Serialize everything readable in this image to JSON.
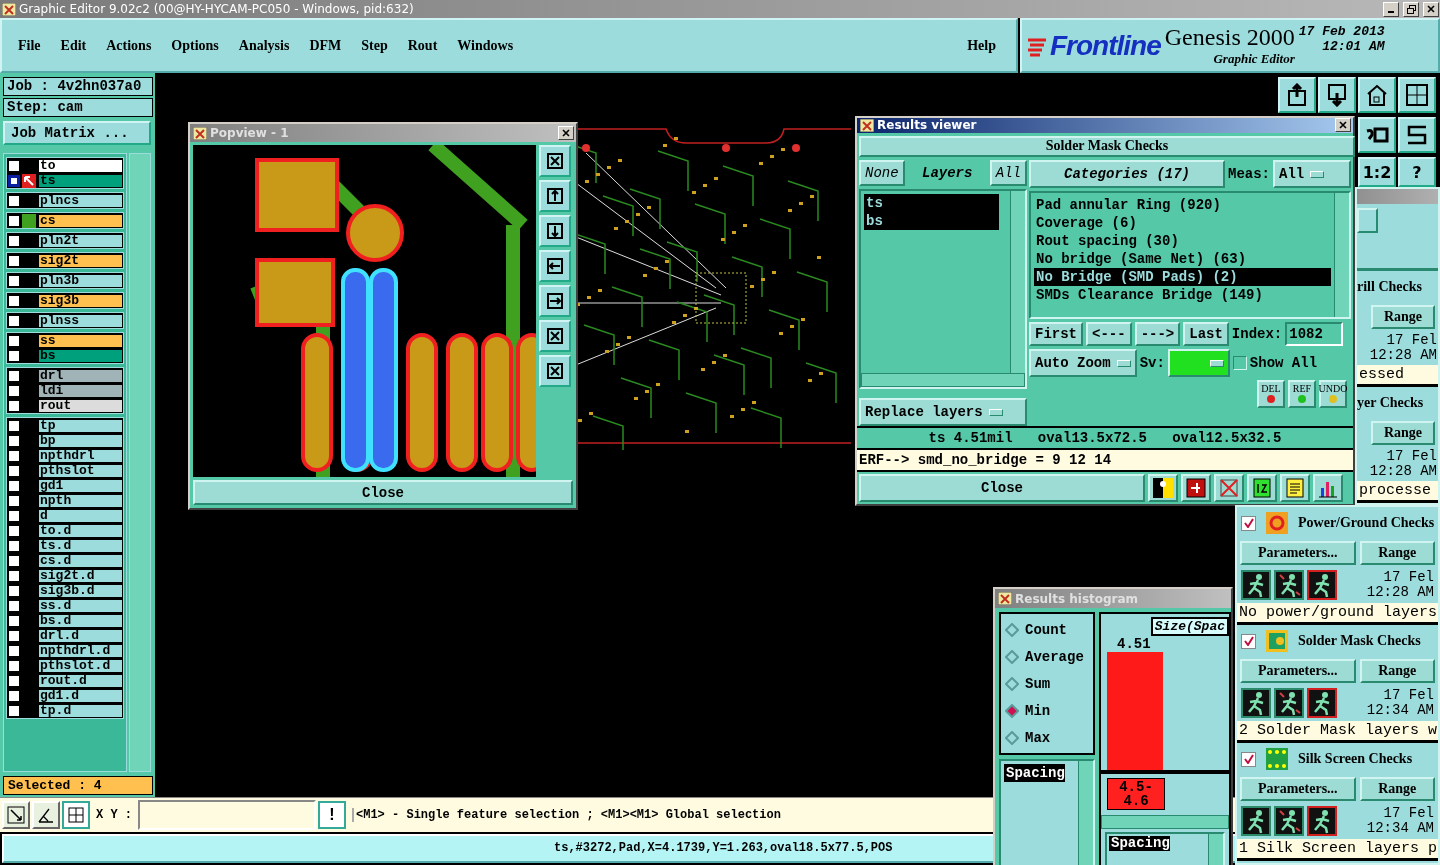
{
  "window": {
    "title": "Graphic Editor 9.02c2 (00@HY-HYCAM-PC050 - Windows, pid:632)"
  },
  "menu": {
    "items": [
      "File",
      "Edit",
      "Actions",
      "Options",
      "Analysis",
      "DFM",
      "Step",
      "Rout",
      "Windows"
    ],
    "help": "Help"
  },
  "brand": {
    "logo": "Frontline",
    "product": "Genesis 2000",
    "subtitle": "Graphic Editor",
    "date": "17 Feb 2013",
    "time": "12:01 AM"
  },
  "job": {
    "job": "Job : 4v2hn037a0",
    "step": "Step: cam",
    "matrix_button": "Job Matrix ..."
  },
  "layer_groups": [
    {
      "layers": [
        {
          "name": "to",
          "color": "#ffffff",
          "selected": false,
          "work": false,
          "shown": false
        },
        {
          "name": "ts",
          "color": "#00a07c",
          "selected": true,
          "work": true,
          "shown": false
        }
      ]
    },
    {
      "layers": [
        {
          "name": "plncs",
          "color": "#9cdcdc",
          "selected": false,
          "work": false,
          "shown": false
        }
      ]
    },
    {
      "layers": [
        {
          "name": "cs",
          "color": "#ffc050",
          "selected": false,
          "work": false,
          "shown": true
        }
      ]
    },
    {
      "layers": [
        {
          "name": "pln2t",
          "color": "#9cdcdc",
          "selected": false,
          "work": false,
          "shown": false
        }
      ]
    },
    {
      "layers": [
        {
          "name": "sig2t",
          "color": "#ffc050",
          "selected": false,
          "work": false,
          "shown": false
        }
      ]
    },
    {
      "layers": [
        {
          "name": "pln3b",
          "color": "#9cdcdc",
          "selected": false,
          "work": false,
          "shown": false
        }
      ]
    },
    {
      "layers": [
        {
          "name": "sig3b",
          "color": "#ffc050",
          "selected": false,
          "work": false,
          "shown": false
        }
      ]
    },
    {
      "layers": [
        {
          "name": "plnss",
          "color": "#9cdcdc",
          "selected": false,
          "work": false,
          "shown": false
        }
      ]
    },
    {
      "layers": [
        {
          "name": "ss",
          "color": "#ffc050",
          "selected": false,
          "work": false,
          "shown": false
        },
        {
          "name": "bs",
          "color": "#00a07c",
          "selected": false,
          "work": false,
          "shown": false
        }
      ]
    },
    {
      "layers": [
        {
          "name": "drl",
          "color": "#a0b4b8",
          "selected": false,
          "work": false,
          "shown": false
        },
        {
          "name": "ldi",
          "color": "#a0b4b8",
          "selected": false,
          "work": false,
          "shown": false
        },
        {
          "name": "rout",
          "color": "#dcdcdc",
          "selected": false,
          "work": false,
          "shown": false
        }
      ]
    },
    {
      "layers": [
        {
          "name": "tp",
          "color": "#9cdcdc",
          "selected": false,
          "work": false,
          "shown": false
        },
        {
          "name": "bp",
          "color": "#9cdcdc",
          "selected": false,
          "work": false,
          "shown": false
        },
        {
          "name": "npthdrl",
          "color": "#9cdcdc",
          "selected": false,
          "work": false,
          "shown": false
        },
        {
          "name": "pthslot",
          "color": "#9cdcdc",
          "selected": false,
          "work": false,
          "shown": false
        },
        {
          "name": "gd1",
          "color": "#9cdcdc",
          "selected": false,
          "work": false,
          "shown": false
        },
        {
          "name": "npth",
          "color": "#9cdcdc",
          "selected": false,
          "work": false,
          "shown": false
        },
        {
          "name": "d",
          "color": "#9cdcdc",
          "selected": false,
          "work": false,
          "shown": false
        },
        {
          "name": "to.d",
          "color": "#9cdcdc",
          "selected": false,
          "work": false,
          "shown": false
        },
        {
          "name": "ts.d",
          "color": "#9cdcdc",
          "selected": false,
          "work": false,
          "shown": false
        },
        {
          "name": "cs.d",
          "color": "#9cdcdc",
          "selected": false,
          "work": false,
          "shown": false
        },
        {
          "name": "sig2t.d",
          "color": "#9cdcdc",
          "selected": false,
          "work": false,
          "shown": false
        },
        {
          "name": "sig3b.d",
          "color": "#9cdcdc",
          "selected": false,
          "work": false,
          "shown": false
        },
        {
          "name": "ss.d",
          "color": "#9cdcdc",
          "selected": false,
          "work": false,
          "shown": false
        },
        {
          "name": "bs.d",
          "color": "#9cdcdc",
          "selected": false,
          "work": false,
          "shown": false
        },
        {
          "name": "drl.d",
          "color": "#9cdcdc",
          "selected": false,
          "work": false,
          "shown": false
        },
        {
          "name": "npthdrl.d",
          "color": "#9cdcdc",
          "selected": false,
          "work": false,
          "shown": false
        },
        {
          "name": "pthslot.d",
          "color": "#9cdcdc",
          "selected": false,
          "work": false,
          "shown": false
        },
        {
          "name": "rout.d",
          "color": "#9cdcdc",
          "selected": false,
          "work": false,
          "shown": false
        },
        {
          "name": "gd1.d",
          "color": "#9cdcdc",
          "selected": false,
          "work": false,
          "shown": false
        },
        {
          "name": "tp.d",
          "color": "#9cdcdc",
          "selected": false,
          "work": false,
          "shown": false
        }
      ]
    }
  ],
  "selected_count": "Selected : 4",
  "toolbar": {
    "texts": [
      "1:2",
      "?"
    ]
  },
  "popview": {
    "title": "Popview - 1",
    "close": "Close"
  },
  "results_viewer": {
    "title": "Results viewer",
    "header": "Solder Mask Checks",
    "none_button": "None",
    "layers_label": "Layers",
    "all_button": "All",
    "layers": [
      {
        "name": "ts",
        "selected": true
      },
      {
        "name": "bs",
        "selected": true
      }
    ],
    "categories_label": "Categories (17)",
    "meas_label": "Meas:",
    "meas_value": "All",
    "categories": [
      {
        "label": "Pad annular Ring (920)",
        "selected": false
      },
      {
        "label": "Coverage (6)",
        "selected": false
      },
      {
        "label": "Rout spacing (30)",
        "selected": false
      },
      {
        "label": "No bridge (Same Net) (63)",
        "selected": false
      },
      {
        "label": "No Bridge (SMD Pads) (2)",
        "selected": true
      },
      {
        "label": "SMDs Clearance Bridge (149)",
        "selected": false
      }
    ],
    "nav_buttons": [
      "First",
      "<---",
      "--->",
      "Last"
    ],
    "index_label": "Index:",
    "index_value": "1082",
    "zoom_mode": "Auto Zoom",
    "sv_label": "Sv:",
    "show_all": {
      "label": "Show All",
      "checked": false
    },
    "replace": "Replace layers",
    "action_buttons": [
      "DEL",
      "REF",
      "UNDO"
    ],
    "info": "ts 4.51mil   oval13.5x72.5   oval12.5x32.5",
    "erf": "ERF--> smd_no_bridge = 9 12 14",
    "close": "Close"
  },
  "histogram": {
    "title": "Results histogram",
    "modes": [
      {
        "label": "Count",
        "selected": false
      },
      {
        "label": "Average",
        "selected": false
      },
      {
        "label": "Sum",
        "selected": false
      },
      {
        "label": "Min",
        "selected": true
      },
      {
        "label": "Max",
        "selected": false
      }
    ],
    "measures": [
      {
        "label": "Spacing",
        "selected": true
      }
    ],
    "column_title": "Size(Spac",
    "bars": [
      {
        "value": "4.51",
        "range": "4.5-4.6"
      }
    ],
    "lower_list": [
      {
        "label": "Spacing",
        "selected": true
      }
    ]
  },
  "checks_upper": [
    {
      "title": "rill Checks",
      "range": "Range",
      "date": "17 Fel",
      "time": "12:28 AM",
      "message": "essed"
    },
    {
      "title": "yer Checks",
      "range": "Range",
      "date": "17 Fel",
      "time": "12:28 AM",
      "message": "processe"
    }
  ],
  "checks": [
    {
      "kind": "power",
      "title": "Power/Ground Checks",
      "checked": true,
      "params": "Parameters...",
      "range": "Range",
      "date": "17 Fel",
      "time": "12:28 AM",
      "message": "No power/ground layers"
    },
    {
      "kind": "mask",
      "title": "Solder Mask Checks",
      "checked": true,
      "params": "Parameters...",
      "range": "Range",
      "date": "17 Fel",
      "time": "12:34 AM",
      "message": "2 Solder Mask layers w"
    },
    {
      "kind": "silk",
      "title": "Silk Screen Checks",
      "checked": true,
      "params": "Parameters...",
      "range": "Range",
      "date": "17 Fel",
      "time": "12:34 AM",
      "message": "1 Silk Screen layers p"
    }
  ],
  "bottom": {
    "xy_label": "X Y :",
    "alert_button": "!",
    "hint": "<M1> - Single feature selection ; <M1><M1> Global selection",
    "status": "ts,#3272,Pad,X=4.1739,Y=1.263,oval18.5x77.5,POS"
  }
}
